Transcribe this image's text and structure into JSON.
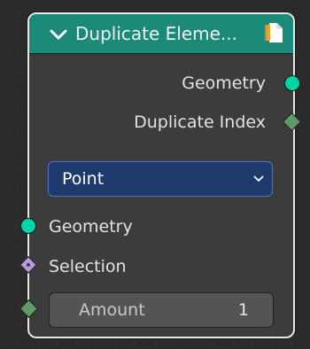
{
  "node": {
    "title": "Duplicate Eleme...",
    "header_color": "#1b8a78",
    "outputs": [
      {
        "label": "Geometry",
        "socket": "circle",
        "socket_color": "#00d6a3"
      },
      {
        "label": "Duplicate Index",
        "socket": "diamond",
        "socket_color": "#5e9b65"
      }
    ],
    "domain_dropdown": {
      "selected": "Point"
    },
    "inputs": [
      {
        "label": "Geometry",
        "socket": "circle",
        "socket_color": "#00d6a3"
      },
      {
        "label": "Selection",
        "socket": "diamond-dot",
        "socket_color": "#b99ad8"
      }
    ],
    "amount": {
      "label": "Amount",
      "value": "1",
      "socket": "diamond",
      "socket_color": "#5e9b65"
    },
    "icons": {
      "collapse": "chevron-down-icon",
      "node_type": "document-icon",
      "dropdown": "chevron-down-icon"
    }
  }
}
